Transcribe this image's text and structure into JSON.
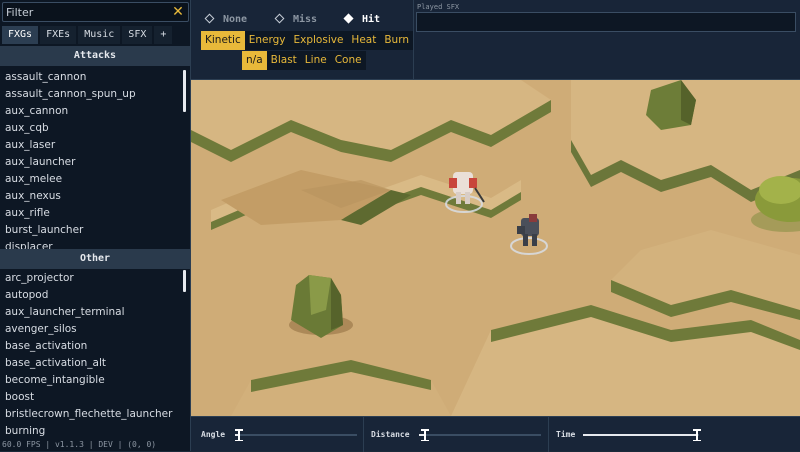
{
  "filter": {
    "placeholder": "Filter",
    "clear_icon": "close-icon"
  },
  "tabs": [
    {
      "label": "FXGs",
      "active": true
    },
    {
      "label": "FXEs",
      "active": false
    },
    {
      "label": "Music",
      "active": false
    },
    {
      "label": "SFX",
      "active": false
    },
    {
      "label": "+",
      "active": false
    }
  ],
  "attacks": {
    "header": "Attacks",
    "items": [
      "assault_cannon",
      "assault_cannon_spun_up",
      "aux_cannon",
      "aux_cqb",
      "aux_laser",
      "aux_launcher",
      "aux_melee",
      "aux_nexus",
      "aux_rifle",
      "burst_launcher",
      "displacer"
    ]
  },
  "other": {
    "header": "Other",
    "items": [
      "arc_projector",
      "autopod",
      "aux_launcher_terminal",
      "avenger_silos",
      "base_activation",
      "base_activation_alt",
      "become_intangible",
      "boost",
      "bristlecrown_flechette_launcher",
      "burning"
    ]
  },
  "status_text": "60.0 FPS | v1.1.3 | DEV | (0, 0)",
  "outcome": {
    "options": [
      {
        "label": "None",
        "selected": false
      },
      {
        "label": "Miss",
        "selected": false
      },
      {
        "label": "Hit",
        "selected": true
      }
    ]
  },
  "damage_types": [
    {
      "label": "Kinetic",
      "active": true
    },
    {
      "label": "Energy",
      "active": false
    },
    {
      "label": "Explosive",
      "active": false
    },
    {
      "label": "Heat",
      "active": false
    },
    {
      "label": "Burn",
      "active": false
    }
  ],
  "area_types": [
    {
      "label": "n/a",
      "active": true
    },
    {
      "label": "Blast",
      "active": false
    },
    {
      "label": "Line",
      "active": false
    },
    {
      "label": "Cone",
      "active": false
    }
  ],
  "played_sfx": {
    "label": "Played SFX",
    "value": ""
  },
  "sliders": {
    "angle": {
      "label": "Angle",
      "fraction": 0.03
    },
    "distance": {
      "label": "Distance",
      "fraction": 0.05
    },
    "time": {
      "label": "Time",
      "fraction": 0.98
    }
  },
  "colors": {
    "accent": "#e8b93a",
    "panel": "#182538",
    "sand": "#c9a673"
  }
}
